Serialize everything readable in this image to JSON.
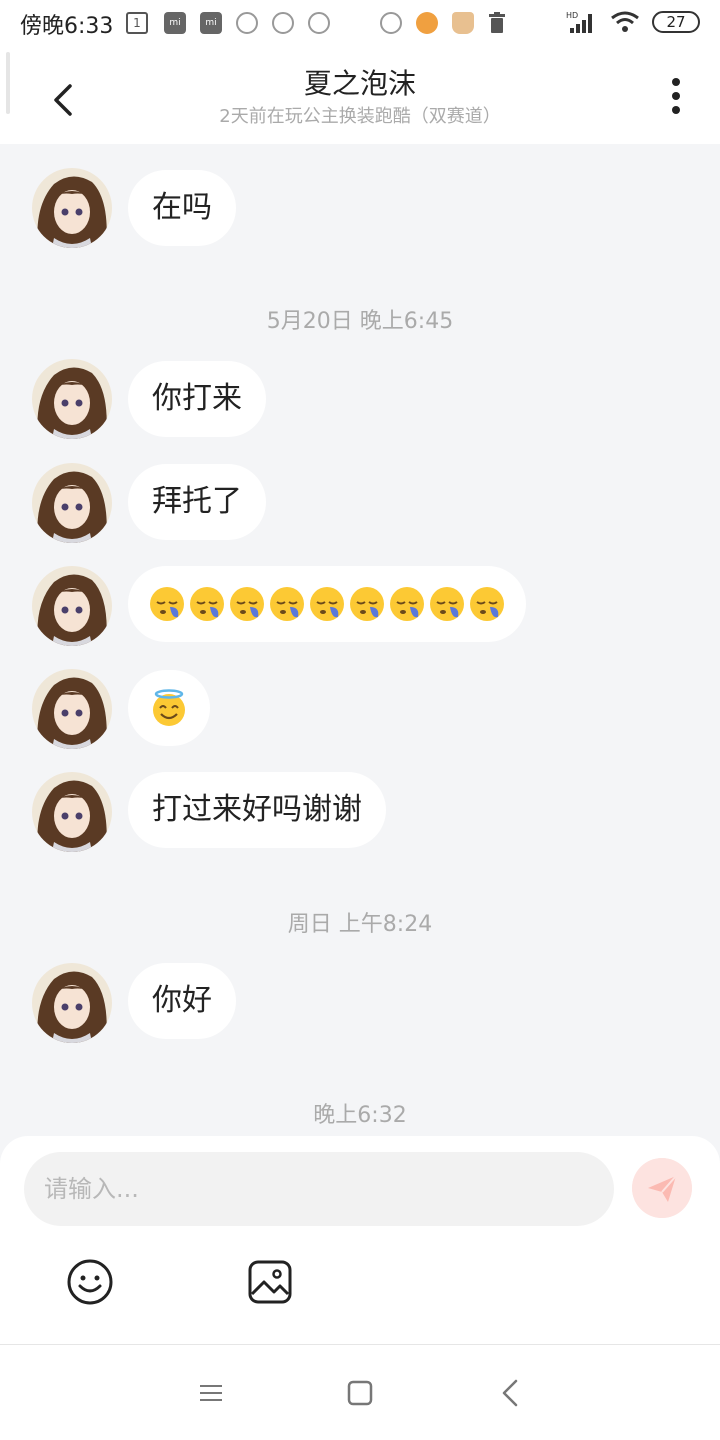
{
  "status_bar": {
    "time": "傍晚6:33",
    "battery": "27",
    "network": "HD"
  },
  "header": {
    "title": "夏之泡沫",
    "subtitle": "2天前在玩公主换装跑酷（双赛道）"
  },
  "messages": [
    {
      "text": "在吗"
    },
    {
      "timestamp": "5月20日 晚上6:45"
    },
    {
      "text": "你打来"
    },
    {
      "text": "拜托了"
    },
    {
      "emoji": "sleeping-face",
      "count": 9
    },
    {
      "emoji": "smiling-face-with-halo",
      "count": 1
    },
    {
      "text": "打过来好吗谢谢"
    },
    {
      "timestamp": "周日 上午8:24"
    },
    {
      "text": "你好"
    },
    {
      "timestamp": "晚上6:32"
    }
  ],
  "input": {
    "placeholder": "请输入..."
  },
  "icons": {
    "back": "chevron-left-icon",
    "more": "more-vertical-icon",
    "send": "send-icon",
    "emoji": "emoji-icon",
    "image": "image-icon"
  },
  "colors": {
    "chat_background": "#f4f5f7",
    "bubble": "#ffffff",
    "send_button": "#fde3e0",
    "timestamp_text": "#aaaaaa"
  }
}
